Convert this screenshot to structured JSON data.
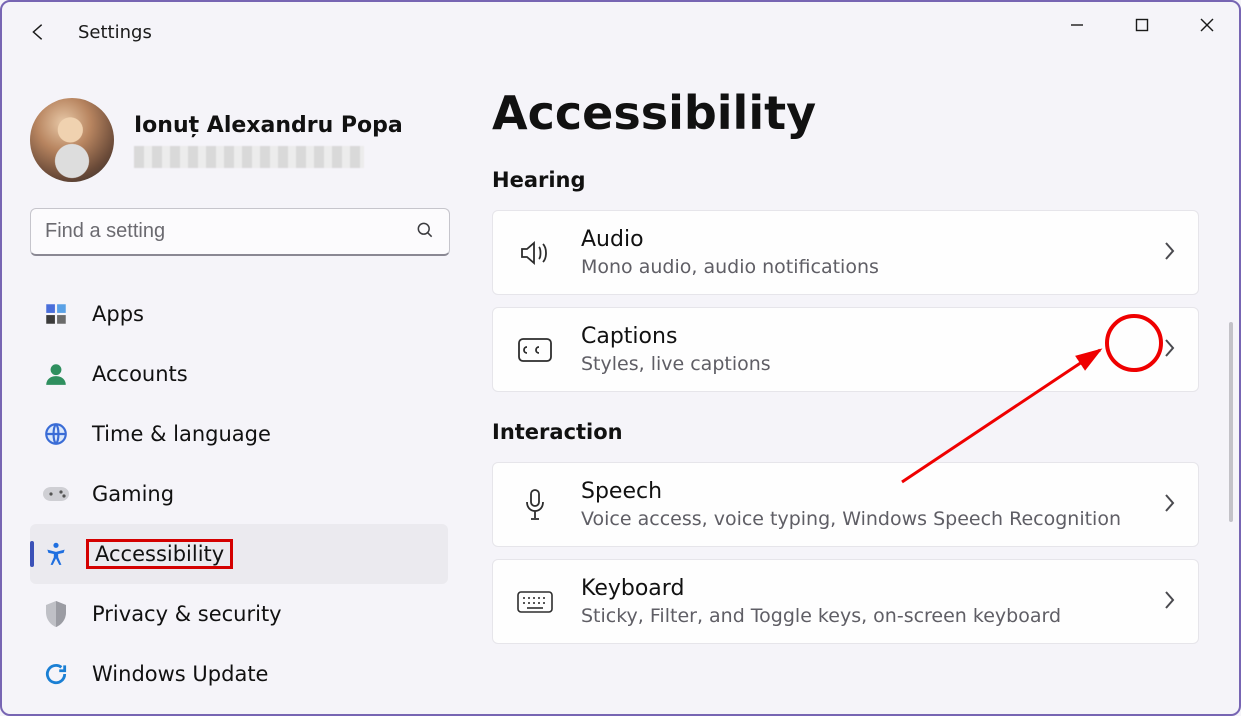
{
  "app_title": "Settings",
  "profile": {
    "name": "Ionuț Alexandru Popa"
  },
  "search": {
    "placeholder": "Find a setting"
  },
  "sidebar": {
    "items": [
      {
        "label": "Apps"
      },
      {
        "label": "Accounts"
      },
      {
        "label": "Time & language"
      },
      {
        "label": "Gaming"
      },
      {
        "label": "Accessibility"
      },
      {
        "label": "Privacy & security"
      },
      {
        "label": "Windows Update"
      }
    ]
  },
  "page": {
    "title": "Accessibility",
    "sections": [
      {
        "title": "Hearing",
        "cards": [
          {
            "title": "Audio",
            "sub": "Mono audio, audio notifications"
          },
          {
            "title": "Captions",
            "sub": "Styles, live captions"
          }
        ]
      },
      {
        "title": "Interaction",
        "cards": [
          {
            "title": "Speech",
            "sub": "Voice access, voice typing, Windows Speech Recognition"
          },
          {
            "title": "Keyboard",
            "sub": "Sticky, Filter, and Toggle keys, on-screen keyboard"
          }
        ]
      }
    ]
  }
}
